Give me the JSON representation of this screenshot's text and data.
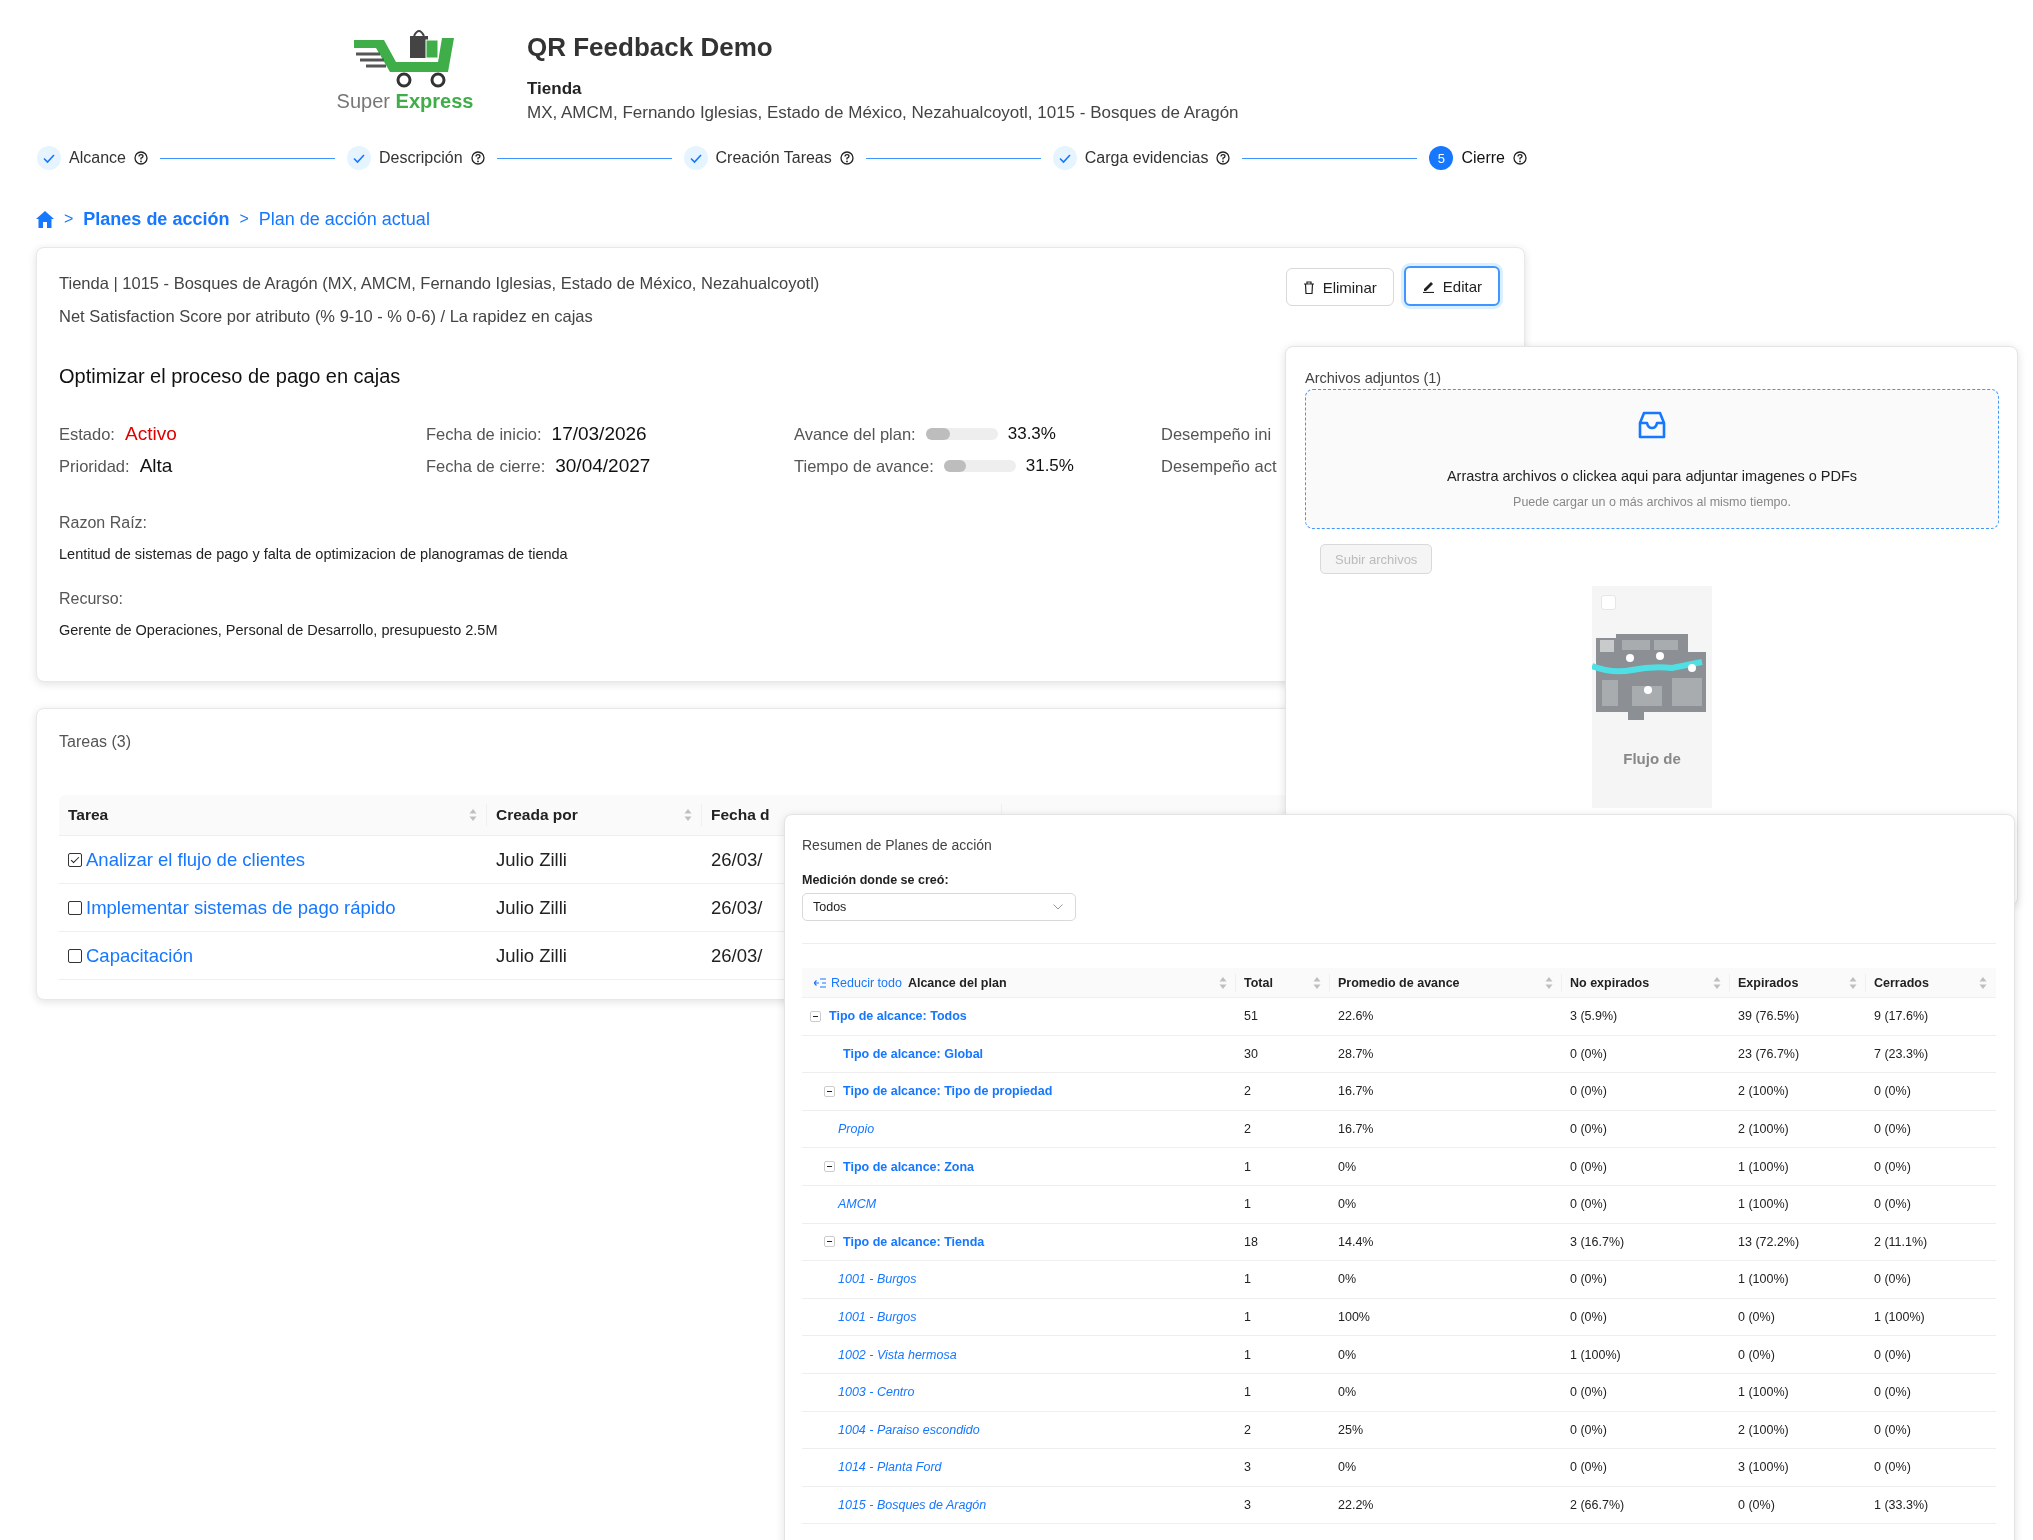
{
  "header": {
    "logo": {
      "text": "Super **Express**"
    },
    "title": "QR Feedback Demo",
    "subtitle": "Tienda",
    "address": "MX, AMCM, Fernando Iglesias, Estado de México, Nezahualcoyotl, 1015 - Bosques de Aragón"
  },
  "steps": [
    {
      "label": "Alcance",
      "completed": true
    },
    {
      "label": "Descripción",
      "completed": true
    },
    {
      "label": "Creación Tareas",
      "completed": true
    },
    {
      "label": "Carga evidencias",
      "completed": true
    },
    {
      "label": "Cierre",
      "completed": false,
      "number": "5"
    }
  ],
  "breadcrumb": [
    {
      "kind": "home"
    },
    {
      "kind": "separator",
      "text": ">"
    },
    {
      "kind": "link",
      "text": "Planes de acción"
    },
    {
      "kind": "separator",
      "text": ">"
    },
    {
      "kind": "current",
      "text": "Plan de acción actual"
    }
  ],
  "plan": {
    "location": "Tienda | 1015 - Bosques de Aragón (MX, AMCM, Fernando Iglesias, Estado de México, Nezahualcoyotl)",
    "metric": "Net Satisfaction Score por atributo (% 9-10 - % 0-6) / La rapidez en cajas",
    "title": "Optimizar el proceso de pago en cajas",
    "actions": [
      {
        "label": "Eliminar",
        "kind": "delete",
        "focused": false
      },
      {
        "label": "Editar",
        "kind": "edit",
        "focused": true
      }
    ],
    "columns": [
      {
        "fields": [
          {
            "label": "Estado:",
            "value": "Activo",
            "kind": "status"
          },
          {
            "label": "Prioridad:",
            "value": "Alta",
            "kind": "text"
          }
        ]
      },
      {
        "fields": [
          {
            "label": "Fecha de inicio:",
            "value": "17/03/2026",
            "kind": "text"
          },
          {
            "label": "Fecha de cierre:",
            "value": "30/04/2027",
            "kind": "text"
          }
        ]
      },
      {
        "fields": [
          {
            "label": "Avance del plan:",
            "value": "33.3%",
            "kind": "progress",
            "level": 0.333
          },
          {
            "label": "Tiempo de avance:",
            "value": "31.5%",
            "kind": "progress",
            "level": 0.315
          }
        ]
      },
      {
        "fields": [
          {
            "label": "Desempeño ini",
            "kind": "label"
          },
          {
            "label": "Desempeño act",
            "kind": "label"
          }
        ]
      }
    ],
    "root_cause": {
      "label": "Razon Raíz:",
      "text": "Lentitud de sistemas de pago y falta de optimizacion de planogramas de tienda"
    },
    "resource": {
      "label": "Recurso:",
      "text": "Gerente de Operaciones, Personal de Desarrollo, presupuesto 2.5M"
    }
  },
  "attachments": {
    "title": "Archivos adjuntos (1)",
    "dropzone": {
      "text": "Arrastra archivos o clickea aqui para adjuntar imagenes o PDFs",
      "hint": "Puede cargar un o más archivos al mismo tiempo."
    },
    "upload_button": {
      "label": "Subir archivos",
      "disabled": true
    },
    "files": [
      {
        "name": "Flujo de",
        "kind": "picture",
        "checked": false
      }
    ]
  },
  "tasks": {
    "title": "Tareas (3)",
    "columns": [
      {
        "label": "Tarea",
        "sortable": true
      },
      {
        "label": "Creada por",
        "sortable": true
      },
      {
        "label": "Fecha d",
        "sortable": false
      }
    ],
    "rows": [
      {
        "name": "Analizar el flujo de clientes",
        "created_by": "Julio Zilli",
        "date": "26/03/",
        "checked": true
      },
      {
        "name": "Implementar sistemas de pago rápido",
        "created_by": "Julio Zilli",
        "date": "26/03/",
        "checked": false
      },
      {
        "name": "Capacitación",
        "created_by": "Julio Zilli",
        "date": "26/03/",
        "checked": false
      }
    ]
  },
  "summary": {
    "title": "Resumen de Planes de acción",
    "filter": {
      "label": "Medición donde se creó:",
      "value": "Todos"
    },
    "collapse_button": "Reducir todo",
    "columns": [
      "Alcance del plan",
      "Total",
      "Promedio de avance",
      "No expirados",
      "Expirados",
      "Cerrados"
    ],
    "rows": [
      {
        "label": "Tipo de alcance: Todos",
        "kind": "group",
        "expanded": true,
        "values": [
          "51",
          "22.6%",
          "3 (5.9%)",
          "39 (76.5%)",
          "9 (17.6%)"
        ],
        "children": [
          {
            "label": "Tipo de alcance: Global",
            "kind": "group",
            "values": [
              "30",
              "28.7%",
              "0 (0%)",
              "23 (76.7%)",
              "7 (23.3%)"
            ]
          },
          {
            "label": "Tipo de alcance: Tipo de propiedad",
            "kind": "group",
            "expanded": true,
            "values": [
              "2",
              "16.7%",
              "0 (0%)",
              "2 (100%)",
              "0 (0%)"
            ],
            "children": [
              {
                "label": "Propio",
                "kind": "item",
                "values": [
                  "2",
                  "16.7%",
                  "0 (0%)",
                  "2 (100%)",
                  "0 (0%)"
                ]
              }
            ]
          },
          {
            "label": "Tipo de alcance: Zona",
            "kind": "group",
            "expanded": true,
            "values": [
              "1",
              "0%",
              "0 (0%)",
              "1 (100%)",
              "0 (0%)"
            ],
            "children": [
              {
                "label": "AMCM",
                "kind": "item",
                "values": [
                  "1",
                  "0%",
                  "0 (0%)",
                  "1 (100%)",
                  "0 (0%)"
                ]
              }
            ]
          },
          {
            "label": "Tipo de alcance: Tienda",
            "kind": "group",
            "expanded": true,
            "values": [
              "18",
              "14.4%",
              "3 (16.7%)",
              "13 (72.2%)",
              "2 (11.1%)"
            ],
            "children": [
              {
                "label": "1001 - Burgos",
                "kind": "item",
                "values": [
                  "1",
                  "0%",
                  "0 (0%)",
                  "1 (100%)",
                  "0 (0%)"
                ]
              },
              {
                "label": "1001 - Burgos",
                "kind": "item",
                "values": [
                  "1",
                  "100%",
                  "0 (0%)",
                  "0 (0%)",
                  "1 (100%)"
                ]
              },
              {
                "label": "1002 - Vista hermosa",
                "kind": "item",
                "values": [
                  "1",
                  "0%",
                  "1 (100%)",
                  "0 (0%)",
                  "0 (0%)"
                ]
              },
              {
                "label": "1003 - Centro",
                "kind": "item",
                "values": [
                  "1",
                  "0%",
                  "0 (0%)",
                  "1 (100%)",
                  "0 (0%)"
                ]
              },
              {
                "label": "1004 - Paraiso escondido",
                "kind": "item",
                "values": [
                  "2",
                  "25%",
                  "0 (0%)",
                  "2 (100%)",
                  "0 (0%)"
                ]
              },
              {
                "label": "1014 - Planta Ford",
                "kind": "item",
                "values": [
                  "3",
                  "0%",
                  "0 (0%)",
                  "3 (100%)",
                  "0 (0%)"
                ]
              },
              {
                "label": "1015 - Bosques de Aragón",
                "kind": "item",
                "values": [
                  "3",
                  "22.2%",
                  "2 (66.7%)",
                  "0 (0%)",
                  "1 (33.3%)"
                ]
              }
            ]
          }
        ]
      }
    ]
  }
}
